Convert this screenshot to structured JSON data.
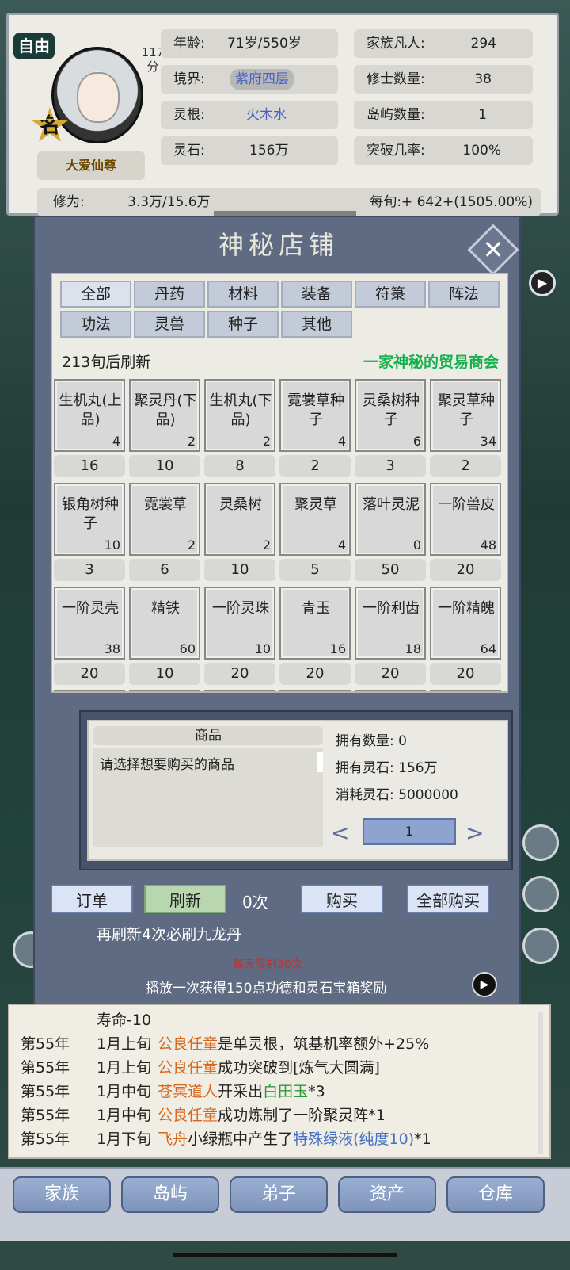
{
  "header": {
    "mode_badge": "自由",
    "score_value": "117",
    "score_unit": "分",
    "name_icon": "名",
    "player_title": "大爱仙尊",
    "stats": {
      "age_label": "年龄:",
      "age_value": "71岁/550岁",
      "realm_label": "境界:",
      "realm_value": "紫府四层",
      "root_label": "灵根:",
      "root_value": "火木水",
      "stone_label": "灵石:",
      "stone_value": "156万",
      "family_label": "家族凡人:",
      "family_value": "294",
      "cultivator_label": "修士数量:",
      "cultivator_value": "38",
      "island_label": "岛屿数量:",
      "island_value": "1",
      "breakthrough_label": "突破几率:",
      "breakthrough_value": "100%"
    },
    "cultivation_label": "修为:",
    "cultivation_value": "3.3万/15.6万",
    "per_period": "每旬:+ 642+(1505.00%)"
  },
  "shop": {
    "title": "神秘店铺",
    "tabs": [
      "全部",
      "丹药",
      "材料",
      "装备",
      "符箓",
      "阵法",
      "功法",
      "灵兽",
      "种子",
      "其他"
    ],
    "refresh_timer": "213旬后刷新",
    "merchant": "一家神秘的贸易商会",
    "items": [
      {
        "name": "生机丸(上品)",
        "count": "4",
        "price": "16"
      },
      {
        "name": "聚灵丹(下品)",
        "count": "2",
        "price": "10"
      },
      {
        "name": "生机丸(下品)",
        "count": "2",
        "price": "8"
      },
      {
        "name": "霓裳草种子",
        "count": "4",
        "price": "2"
      },
      {
        "name": "灵桑树种子",
        "count": "6",
        "price": "3"
      },
      {
        "name": "聚灵草种子",
        "count": "34",
        "price": "2"
      },
      {
        "name": "银角树种子",
        "count": "10",
        "price": "3"
      },
      {
        "name": "霓裳草",
        "count": "2",
        "price": "6"
      },
      {
        "name": "灵桑树",
        "count": "2",
        "price": "10"
      },
      {
        "name": "聚灵草",
        "count": "4",
        "price": "5"
      },
      {
        "name": "落叶灵泥",
        "count": "0",
        "price": "50"
      },
      {
        "name": "一阶兽皮",
        "count": "48",
        "price": "20"
      },
      {
        "name": "一阶灵壳",
        "count": "38",
        "price": "20"
      },
      {
        "name": "精铁",
        "count": "60",
        "price": "10"
      },
      {
        "name": "一阶灵珠",
        "count": "10",
        "price": "20"
      },
      {
        "name": "青玉",
        "count": "16",
        "price": "20"
      },
      {
        "name": "一阶利齿",
        "count": "18",
        "price": "20"
      },
      {
        "name": "一阶精魄",
        "count": "64",
        "price": "20"
      }
    ],
    "detail": {
      "product_header": "商品",
      "product_desc": "请选择想要购买的商品",
      "owned_qty": "拥有数量: 0",
      "owned_stone": "拥有灵石: 156万",
      "cost_stone": "消耗灵石: 5000000",
      "qty": "1"
    },
    "buttons": {
      "order": "订单",
      "refresh": "刷新",
      "refresh_count": "0次",
      "buy": "购买",
      "buy_all": "全部购买"
    },
    "pity_text": "再刷新4次必刷九龙丹",
    "limit_text": "每天限制30次",
    "ad_text": "播放一次获得150点功德和灵石宝箱奖励"
  },
  "log": {
    "first_line": "寿命-10",
    "rows": [
      {
        "year": "第55年",
        "period": "1月上旬",
        "actor": "公良任童",
        "text": "是单灵根，筑基机率额外+25%",
        "tail": ""
      },
      {
        "year": "第55年",
        "period": "1月上旬",
        "actor": "公良任童",
        "text": "成功突破到[炼气大圆满]",
        "tail": ""
      },
      {
        "year": "第55年",
        "period": "1月中旬",
        "actor": "苍冥道人",
        "text": "开采出",
        "item": "白田玉",
        "tail": "*3"
      },
      {
        "year": "第55年",
        "period": "1月中旬",
        "actor": "公良任童",
        "text": "成功炼制了一阶聚灵阵*1",
        "tail": ""
      },
      {
        "year": "第55年",
        "period": "1月下旬",
        "actor": "飞舟",
        "text": "小绿瓶中产生了",
        "item2": "特殊绿液(纯度10)",
        "tail": "*1"
      }
    ]
  },
  "nav": [
    "家族",
    "岛屿",
    "弟子",
    "资产",
    "仓库"
  ],
  "colors": {
    "merchant": "#16b04e",
    "realm": "#4660c8",
    "actor": "#d8671a",
    "item": "#2b9a39",
    "special": "#4670c4",
    "limit": "#c03030"
  }
}
